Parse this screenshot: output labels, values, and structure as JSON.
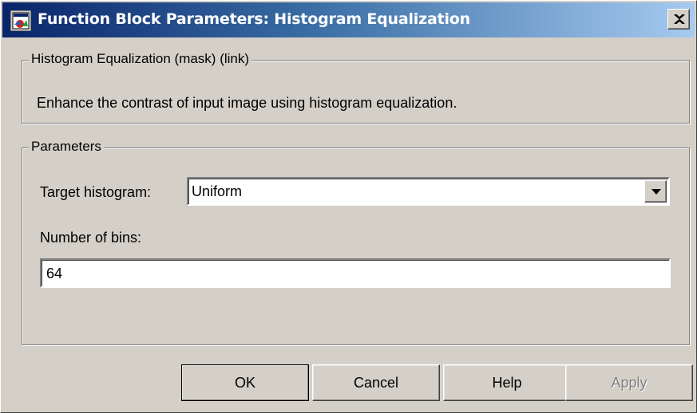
{
  "window": {
    "title": "Function Block Parameters: Histogram Equalization",
    "icon": "simulink-block-icon",
    "close_icon": "close-icon"
  },
  "description_group": {
    "legend": "Histogram Equalization (mask) (link)",
    "text": "Enhance the contrast of input image using histogram equalization."
  },
  "parameters_group": {
    "legend": "Parameters",
    "target_histogram": {
      "label": "Target histogram:",
      "value": "Uniform"
    },
    "number_of_bins": {
      "label": "Number of bins:",
      "value": "64"
    }
  },
  "buttons": {
    "ok": "OK",
    "cancel": "Cancel",
    "help": "Help",
    "apply": "Apply"
  },
  "colors": {
    "face": "#d4d0c8",
    "title_start": "#0a246a",
    "title_end": "#a6caf0"
  }
}
